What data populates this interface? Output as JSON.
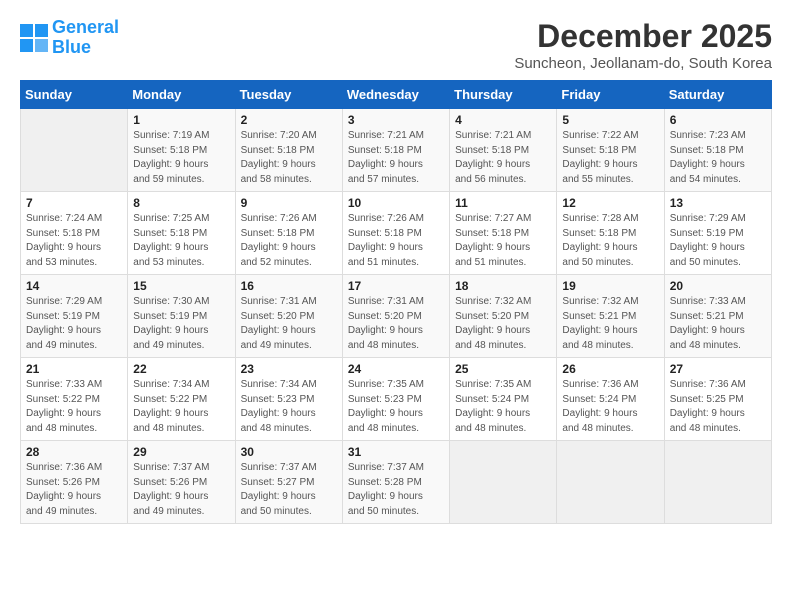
{
  "header": {
    "logo_line1": "General",
    "logo_line2": "Blue",
    "month": "December 2025",
    "location": "Suncheon, Jeollanam-do, South Korea"
  },
  "days_of_week": [
    "Sunday",
    "Monday",
    "Tuesday",
    "Wednesday",
    "Thursday",
    "Friday",
    "Saturday"
  ],
  "weeks": [
    [
      {
        "day": "",
        "info": ""
      },
      {
        "day": "1",
        "info": "Sunrise: 7:19 AM\nSunset: 5:18 PM\nDaylight: 9 hours\nand 59 minutes."
      },
      {
        "day": "2",
        "info": "Sunrise: 7:20 AM\nSunset: 5:18 PM\nDaylight: 9 hours\nand 58 minutes."
      },
      {
        "day": "3",
        "info": "Sunrise: 7:21 AM\nSunset: 5:18 PM\nDaylight: 9 hours\nand 57 minutes."
      },
      {
        "day": "4",
        "info": "Sunrise: 7:21 AM\nSunset: 5:18 PM\nDaylight: 9 hours\nand 56 minutes."
      },
      {
        "day": "5",
        "info": "Sunrise: 7:22 AM\nSunset: 5:18 PM\nDaylight: 9 hours\nand 55 minutes."
      },
      {
        "day": "6",
        "info": "Sunrise: 7:23 AM\nSunset: 5:18 PM\nDaylight: 9 hours\nand 54 minutes."
      }
    ],
    [
      {
        "day": "7",
        "info": "Sunrise: 7:24 AM\nSunset: 5:18 PM\nDaylight: 9 hours\nand 53 minutes."
      },
      {
        "day": "8",
        "info": "Sunrise: 7:25 AM\nSunset: 5:18 PM\nDaylight: 9 hours\nand 53 minutes."
      },
      {
        "day": "9",
        "info": "Sunrise: 7:26 AM\nSunset: 5:18 PM\nDaylight: 9 hours\nand 52 minutes."
      },
      {
        "day": "10",
        "info": "Sunrise: 7:26 AM\nSunset: 5:18 PM\nDaylight: 9 hours\nand 51 minutes."
      },
      {
        "day": "11",
        "info": "Sunrise: 7:27 AM\nSunset: 5:18 PM\nDaylight: 9 hours\nand 51 minutes."
      },
      {
        "day": "12",
        "info": "Sunrise: 7:28 AM\nSunset: 5:18 PM\nDaylight: 9 hours\nand 50 minutes."
      },
      {
        "day": "13",
        "info": "Sunrise: 7:29 AM\nSunset: 5:19 PM\nDaylight: 9 hours\nand 50 minutes."
      }
    ],
    [
      {
        "day": "14",
        "info": "Sunrise: 7:29 AM\nSunset: 5:19 PM\nDaylight: 9 hours\nand 49 minutes."
      },
      {
        "day": "15",
        "info": "Sunrise: 7:30 AM\nSunset: 5:19 PM\nDaylight: 9 hours\nand 49 minutes."
      },
      {
        "day": "16",
        "info": "Sunrise: 7:31 AM\nSunset: 5:20 PM\nDaylight: 9 hours\nand 49 minutes."
      },
      {
        "day": "17",
        "info": "Sunrise: 7:31 AM\nSunset: 5:20 PM\nDaylight: 9 hours\nand 48 minutes."
      },
      {
        "day": "18",
        "info": "Sunrise: 7:32 AM\nSunset: 5:20 PM\nDaylight: 9 hours\nand 48 minutes."
      },
      {
        "day": "19",
        "info": "Sunrise: 7:32 AM\nSunset: 5:21 PM\nDaylight: 9 hours\nand 48 minutes."
      },
      {
        "day": "20",
        "info": "Sunrise: 7:33 AM\nSunset: 5:21 PM\nDaylight: 9 hours\nand 48 minutes."
      }
    ],
    [
      {
        "day": "21",
        "info": "Sunrise: 7:33 AM\nSunset: 5:22 PM\nDaylight: 9 hours\nand 48 minutes."
      },
      {
        "day": "22",
        "info": "Sunrise: 7:34 AM\nSunset: 5:22 PM\nDaylight: 9 hours\nand 48 minutes."
      },
      {
        "day": "23",
        "info": "Sunrise: 7:34 AM\nSunset: 5:23 PM\nDaylight: 9 hours\nand 48 minutes."
      },
      {
        "day": "24",
        "info": "Sunrise: 7:35 AM\nSunset: 5:23 PM\nDaylight: 9 hours\nand 48 minutes."
      },
      {
        "day": "25",
        "info": "Sunrise: 7:35 AM\nSunset: 5:24 PM\nDaylight: 9 hours\nand 48 minutes."
      },
      {
        "day": "26",
        "info": "Sunrise: 7:36 AM\nSunset: 5:24 PM\nDaylight: 9 hours\nand 48 minutes."
      },
      {
        "day": "27",
        "info": "Sunrise: 7:36 AM\nSunset: 5:25 PM\nDaylight: 9 hours\nand 48 minutes."
      }
    ],
    [
      {
        "day": "28",
        "info": "Sunrise: 7:36 AM\nSunset: 5:26 PM\nDaylight: 9 hours\nand 49 minutes."
      },
      {
        "day": "29",
        "info": "Sunrise: 7:37 AM\nSunset: 5:26 PM\nDaylight: 9 hours\nand 49 minutes."
      },
      {
        "day": "30",
        "info": "Sunrise: 7:37 AM\nSunset: 5:27 PM\nDaylight: 9 hours\nand 50 minutes."
      },
      {
        "day": "31",
        "info": "Sunrise: 7:37 AM\nSunset: 5:28 PM\nDaylight: 9 hours\nand 50 minutes."
      },
      {
        "day": "",
        "info": ""
      },
      {
        "day": "",
        "info": ""
      },
      {
        "day": "",
        "info": ""
      }
    ]
  ]
}
